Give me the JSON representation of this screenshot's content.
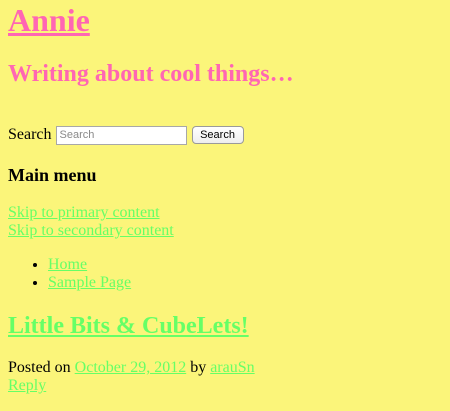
{
  "site": {
    "title": "Annie",
    "description": "Writing about cool things…"
  },
  "search": {
    "label": "Search",
    "placeholder": "Search",
    "button_label": "Search"
  },
  "menu": {
    "heading": "Main menu",
    "skip_links": [
      "Skip to primary content",
      "Skip to secondary content"
    ],
    "items": [
      {
        "label": "Home"
      },
      {
        "label": "Sample Page"
      }
    ]
  },
  "post": {
    "title": "Little Bits & CubeLets!",
    "posted_on_label": "Posted on",
    "date": "October 29, 2012",
    "by_label": "by",
    "author": "arauSn",
    "reply_label": "Reply"
  },
  "colors": {
    "background": "#fbf57a",
    "site_title": "#ff66b3",
    "link": "#66ff66"
  }
}
